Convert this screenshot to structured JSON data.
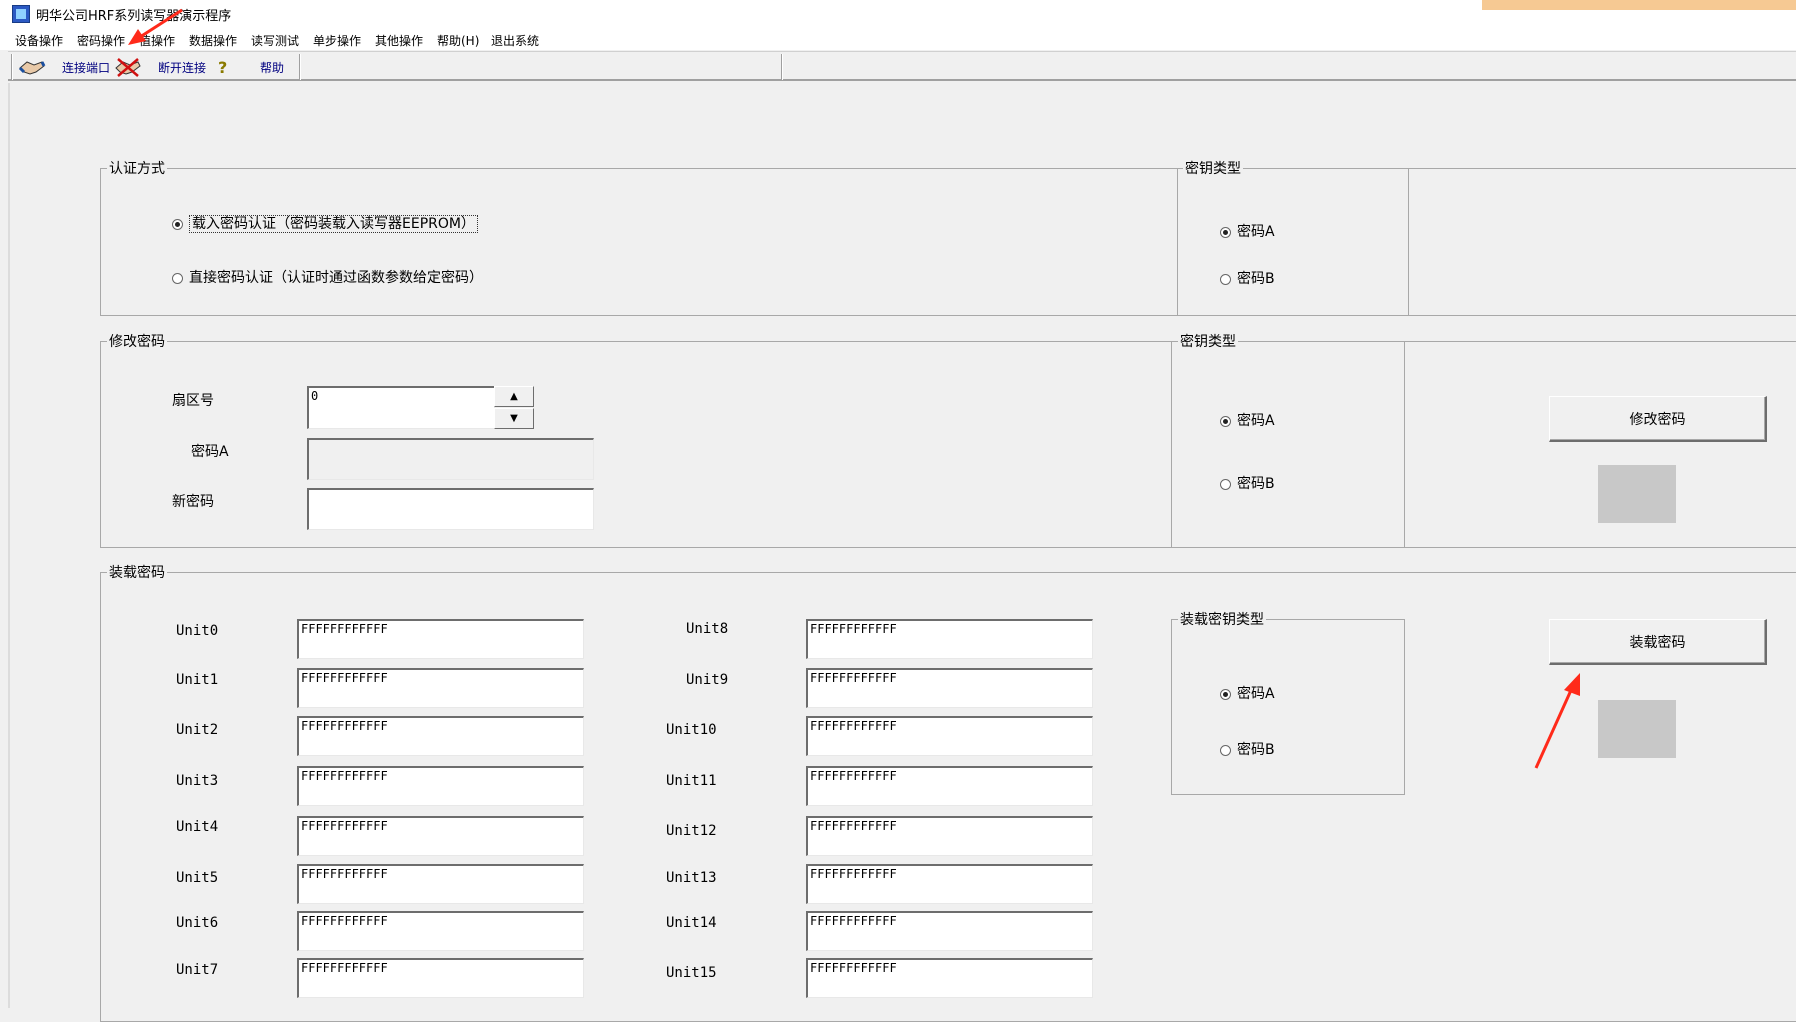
{
  "window": {
    "title": "明华公司HRF系列读写器演示程序"
  },
  "menu": [
    "设备操作",
    "密码操作",
    "值操作",
    "数据操作",
    "读写测试",
    "单步操作",
    "其他操作",
    "帮助(H)",
    "退出系统"
  ],
  "toolbar": {
    "connect": "连接端口",
    "disconnect": "断开连接",
    "help": "帮助"
  },
  "auth": {
    "title": "认证方式",
    "option_load": "载入密码认证（密码装载入读写器EEPROM）",
    "option_direct": "直接密码认证（认证时通过函数参数给定密码）",
    "selected": "load"
  },
  "key_type_1": {
    "title": "密钥类型",
    "a": "密码A",
    "b": "密码B",
    "selected": "A"
  },
  "change_pwd": {
    "title": "修改密码",
    "sector_label": "扇区号",
    "sector_value": "0",
    "pwd_a_label": "密码A",
    "pwd_a_value": "",
    "new_pwd_label": "新密码",
    "new_pwd_value": "",
    "key_title": "密钥类型",
    "key_a": "密码A",
    "key_b": "密码B",
    "key_selected": "A",
    "button": "修改密码"
  },
  "load_pwd": {
    "title": "装载密码",
    "units_left": [
      {
        "label": "Unit0",
        "value": "FFFFFFFFFFFF"
      },
      {
        "label": "Unit1",
        "value": "FFFFFFFFFFFF"
      },
      {
        "label": "Unit2",
        "value": "FFFFFFFFFFFF"
      },
      {
        "label": "Unit3",
        "value": "FFFFFFFFFFFF"
      },
      {
        "label": "Unit4",
        "value": "FFFFFFFFFFFF"
      },
      {
        "label": "Unit5",
        "value": "FFFFFFFFFFFF"
      },
      {
        "label": "Unit6",
        "value": "FFFFFFFFFFFF"
      },
      {
        "label": "Unit7",
        "value": "FFFFFFFFFFFF"
      }
    ],
    "units_right": [
      {
        "label": "Unit8",
        "value": "FFFFFFFFFFFF"
      },
      {
        "label": "Unit9",
        "value": "FFFFFFFFFFFF"
      },
      {
        "label": "Unit10",
        "value": "FFFFFFFFFFFF"
      },
      {
        "label": "Unit11",
        "value": "FFFFFFFFFFFF"
      },
      {
        "label": "Unit12",
        "value": "FFFFFFFFFFFF"
      },
      {
        "label": "Unit13",
        "value": "FFFFFFFFFFFF"
      },
      {
        "label": "Unit14",
        "value": "FFFFFFFFFFFF"
      },
      {
        "label": "Unit15",
        "value": "FFFFFFFFFFFF"
      }
    ],
    "key_title": "装载密钥类型",
    "key_a": "密码A",
    "key_b": "密码B",
    "key_selected": "A",
    "button": "装载密码"
  },
  "colors": {
    "annotation_arrow": "#ff2a1a",
    "menu_text": "#000000",
    "toolbar_text": "#000080"
  }
}
